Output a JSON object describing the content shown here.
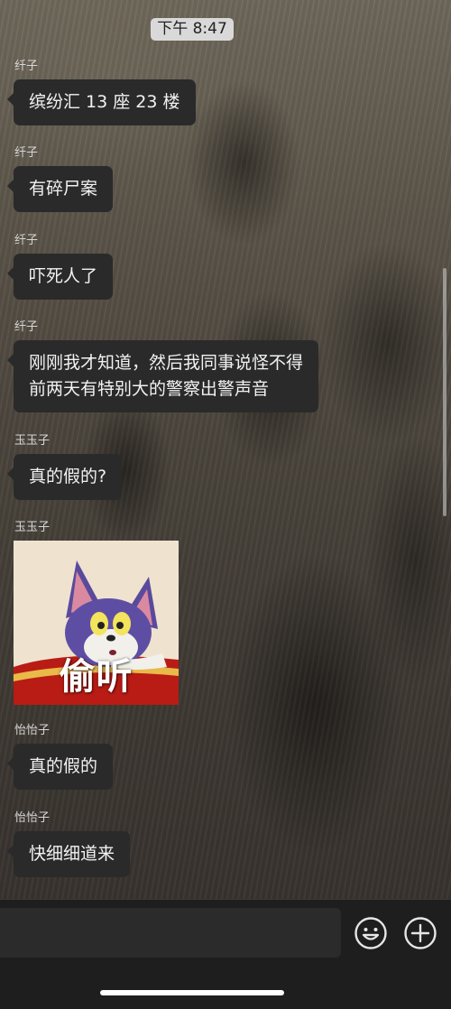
{
  "status": {
    "time": "下午 8:47"
  },
  "messages": [
    {
      "sender": "纤子",
      "text": "缤纷汇 13 座 23 楼"
    },
    {
      "sender": "纤子",
      "text": "有碎尸案"
    },
    {
      "sender": "纤子",
      "text": "吓死人了"
    },
    {
      "sender": "纤子",
      "text": "刚刚我才知道，然后我同事说怪不得\n前两天有特别大的警察出警声音"
    },
    {
      "sender": "玉玉子",
      "text": "真的假的?"
    },
    {
      "sender": "玉玉子",
      "sticker_text": "偷听"
    },
    {
      "sender": "怡怡子",
      "text": "真的假的"
    },
    {
      "sender": "怡怡子",
      "text": "快细细道来"
    }
  ],
  "input": {
    "placeholder": ""
  },
  "icons": {
    "emoji": "smiley-face-icon",
    "add": "plus-circle-icon"
  }
}
